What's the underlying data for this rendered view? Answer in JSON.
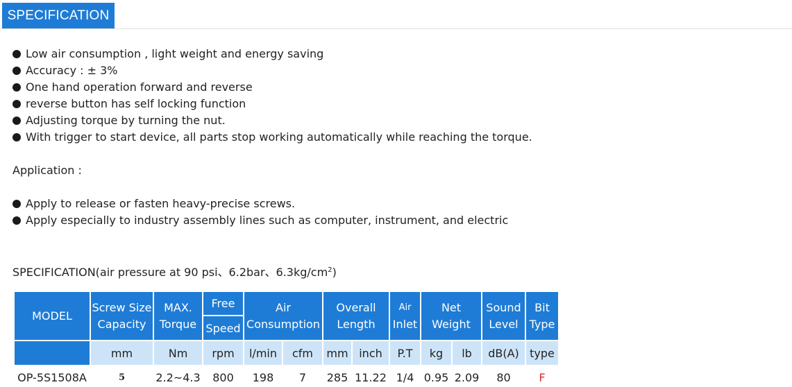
{
  "tab": {
    "label": "SPECIFICATION"
  },
  "features": [
    "Low air consumption , light weight and energy saving",
    "Accuracy : ± 3%",
    "One hand operation forward and reverse",
    "reverse button has self locking function",
    "Adjusting torque by turning the nut.",
    "With trigger to start device, all parts stop working automatically while reaching the torque."
  ],
  "application": {
    "heading": "Application :",
    "items": [
      "Apply to release or fasten heavy-precise screws.",
      "Apply especially to industry assembly lines such as computer, instrument, and electric"
    ]
  },
  "spec_caption": {
    "text": "SPECIFICATION(air pressure at 90 psi、6.2bar、6.3kg/cm",
    "sup": "2",
    "tail": ")"
  },
  "table": {
    "headers": {
      "model": "MODEL",
      "screw_size_1": "Screw Size",
      "screw_size_2": "Capacity",
      "max_torque_1": "MAX.",
      "max_torque_2": "Torque",
      "free": "Free",
      "speed": "Speed",
      "air_consumption_1": "Air",
      "air_consumption_2": "Consumption",
      "overall_length_1": "Overall",
      "overall_length_2": "Length",
      "air_inlet_1": "Air",
      "air_inlet_2": "Inlet",
      "net_weight_1": "Net",
      "net_weight_2": "Weight",
      "sound_level_1": "Sound",
      "sound_level_2": "Level",
      "bit_type_1": "Bit",
      "bit_type_2": "Type"
    },
    "units": [
      "mm",
      "Nm",
      "rpm",
      "l/min",
      "cfm",
      "mm",
      "inch",
      "P.T",
      "kg",
      "lb",
      "dB(A)",
      "type"
    ],
    "rows": [
      [
        "OP-5S1508A",
        "5",
        "2.2~4.3",
        "800",
        "198",
        "7",
        "285",
        "11.22",
        "1/4",
        "0.95",
        "2.09",
        "80",
        "F"
      ]
    ]
  },
  "colors": {
    "header_blue": "#1e7cd6",
    "unit_row_blue": "#cde4f8",
    "bit_type_red": "#d0302a"
  }
}
